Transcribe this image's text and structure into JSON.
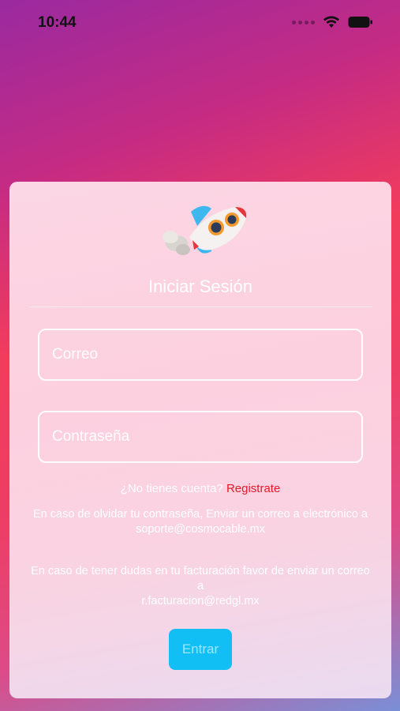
{
  "status_bar": {
    "time": "10:44"
  },
  "login": {
    "title": "Iniciar Sesión",
    "email_placeholder": "Correo",
    "password_placeholder": "Contraseña",
    "signup_prompt": "¿No tienes cuenta?",
    "signup_link": "Registrate",
    "forgot_text_1": "En caso de olvidar tu contraseña, Enviar un correo a electrónico a",
    "forgot_email": "soporte@cosmocable.mx",
    "billing_text_1": "En caso de tener dudas en tu facturación favor de enviar un correo a",
    "billing_email": "r.facturacion@redgl.mx",
    "submit_label": "Entrar"
  },
  "icons": [
    "wifi-icon",
    "battery-icon",
    "rocket-icon"
  ],
  "colors": {
    "link": "#e8172a",
    "button": "#12bff5"
  }
}
